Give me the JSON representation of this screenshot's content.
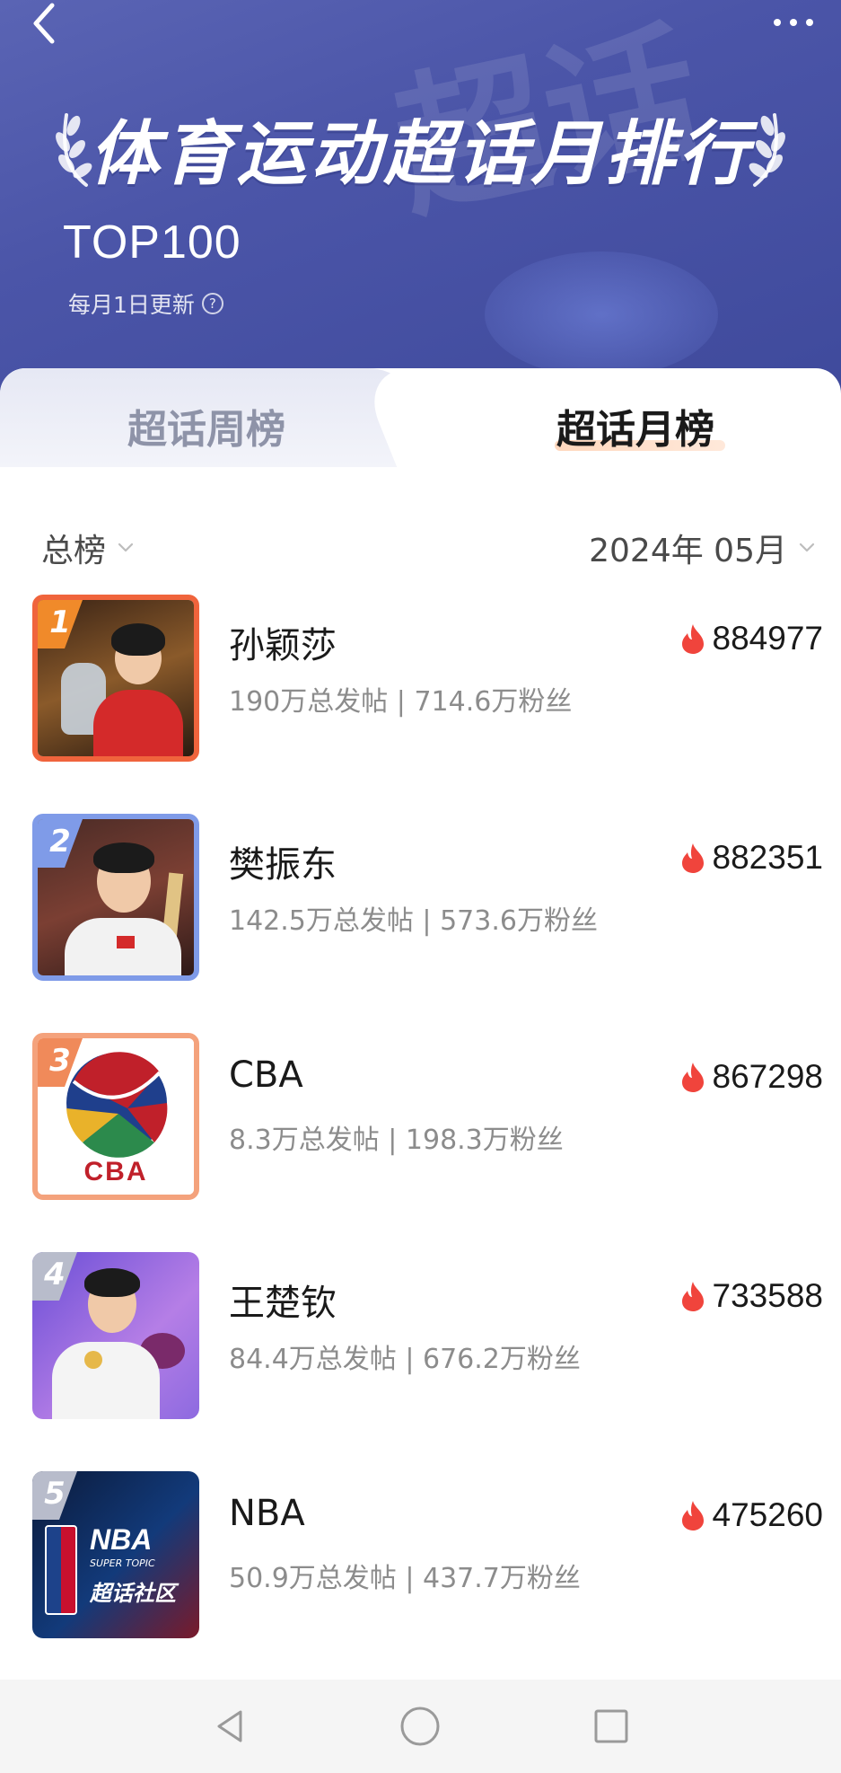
{
  "header": {
    "title": "体育运动超话月排行",
    "top_label": "TOP100",
    "update_note": "每月1日更新",
    "help_icon": "question-circle-icon",
    "back_icon": "chevron-left-icon",
    "more_icon": "more-dots-icon",
    "watermark": "超话"
  },
  "tabs": [
    {
      "label": "超话周榜",
      "active": false
    },
    {
      "label": "超话月榜",
      "active": true
    }
  ],
  "filters": {
    "category": "总榜",
    "period": "2024年 05月"
  },
  "ranking": [
    {
      "rank": "1",
      "name": "孙颖莎",
      "stats": "190万总发帖 | 714.6万粉丝",
      "heat": "884977",
      "frame_color": "#f0643c",
      "badge_color": "#f08a2a"
    },
    {
      "rank": "2",
      "name": "樊振东",
      "stats": "142.5万总发帖 | 573.6万粉丝",
      "heat": "882351",
      "frame_color": "#7f9be8",
      "badge_color": "#7f9be8"
    },
    {
      "rank": "3",
      "name": "CBA",
      "stats": "8.3万总发帖 | 198.3万粉丝",
      "heat": "867298",
      "frame_color": "#f4a27c",
      "badge_color": "#f08a5a"
    },
    {
      "rank": "4",
      "name": "王楚钦",
      "stats": "84.4万总发帖 | 676.2万粉丝",
      "heat": "733588",
      "frame_color": "#ffffff",
      "badge_color": "#b8bccb"
    },
    {
      "rank": "5",
      "name": "NBA",
      "stats": "50.9万总发帖 | 437.7万粉丝",
      "heat": "475260",
      "frame_color": "#ffffff",
      "badge_color": "#b8bccb"
    }
  ],
  "thumb_text": {
    "cba_logo": "CBA",
    "nba_title": "NBA",
    "nba_sub": "SUPER TOPIC",
    "nba_community": "超话社区"
  },
  "navbar": {
    "back_icon": "triangle-back-icon",
    "home_icon": "circle-home-icon",
    "recents_icon": "square-recents-icon"
  },
  "colors": {
    "header_bg": "#4b55a8",
    "flame": "#f0443c",
    "tab_highlight": "#ffd3b6"
  }
}
